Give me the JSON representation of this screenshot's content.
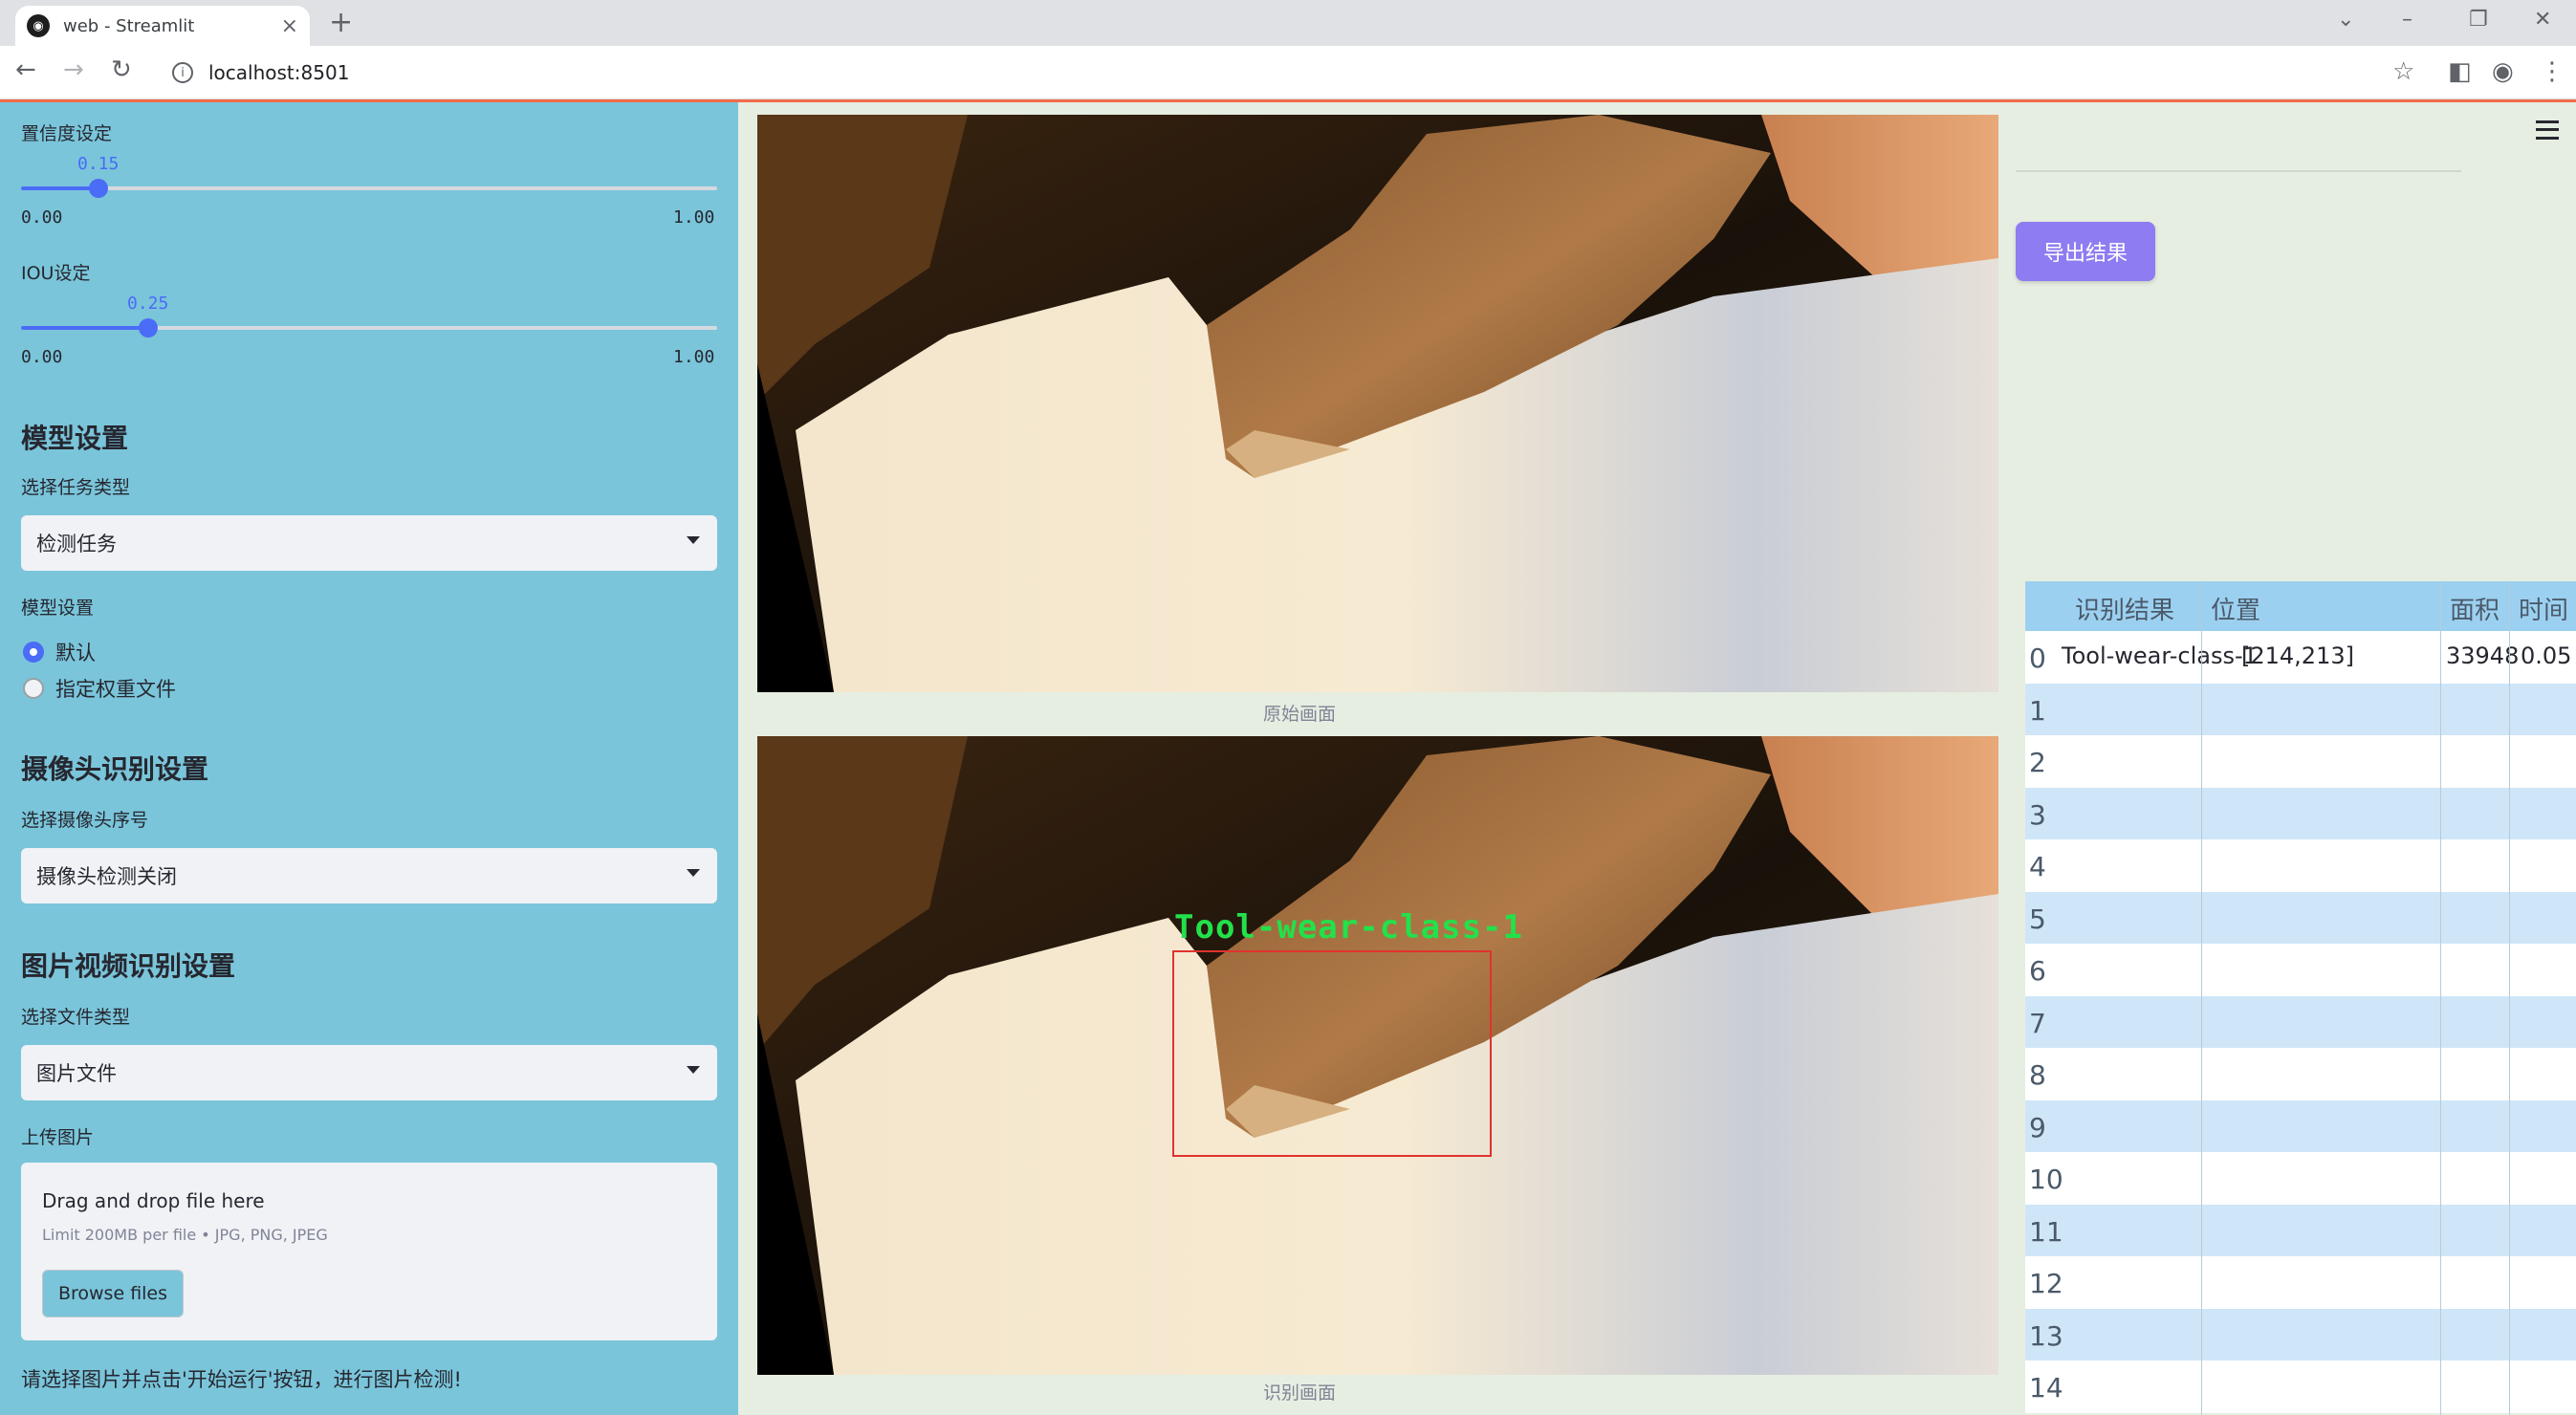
{
  "browser": {
    "tab_title": "web - Streamlit",
    "url": "localhost:8501"
  },
  "sidebar": {
    "confidence": {
      "label": "置信度设定",
      "value": "0.15",
      "level": 0.15,
      "min": "0.00",
      "max": "1.00"
    },
    "iou": {
      "label": "IOU设定",
      "value": "0.25",
      "level": 0.25,
      "min": "0.00",
      "max": "1.00"
    },
    "model_header": "模型设置",
    "task_label": "选择任务类型",
    "task_value": "检测任务",
    "model_label": "模型设置",
    "model_options": [
      "默认",
      "指定权重文件"
    ],
    "model_selected": 0,
    "camera_header": "摄像头识别设置",
    "camera_label": "选择摄像头序号",
    "camera_value": "摄像头检测关闭",
    "media_header": "图片视频识别设置",
    "file_type_label": "选择文件类型",
    "file_type_value": "图片文件",
    "upload_label": "上传图片",
    "uploader": {
      "drag_text": "Drag and drop file here",
      "limit_text": "Limit 200MB per file • JPG, PNG, JPEG",
      "browse_label": "Browse files"
    },
    "hint": "请选择图片并点击'开始运行'按钮，进行图片检测!"
  },
  "main": {
    "original_caption": "原始画面",
    "detected_caption": "识别画面",
    "detection_label": "Tool-wear-class-1"
  },
  "right": {
    "export_label": "导出结果",
    "table": {
      "headers": [
        "",
        "识别结果",
        "位置",
        "面积",
        "时间"
      ],
      "rows": [
        {
          "idx": "0",
          "result": "Tool-wear-class-1",
          "position": "[214,213]",
          "area": "33948",
          "time": "0.05"
        },
        {
          "idx": "1"
        },
        {
          "idx": "2"
        },
        {
          "idx": "3"
        },
        {
          "idx": "4"
        },
        {
          "idx": "5"
        },
        {
          "idx": "6"
        },
        {
          "idx": "7"
        },
        {
          "idx": "8"
        },
        {
          "idx": "9"
        },
        {
          "idx": "10"
        },
        {
          "idx": "11"
        },
        {
          "idx": "12"
        },
        {
          "idx": "13"
        },
        {
          "idx": "14"
        }
      ]
    }
  },
  "colors": {
    "sidebar_bg": "#7ac5da",
    "accent": "#4a6cf7",
    "export_button": "#8e7cf2",
    "detection_text": "#22e14a",
    "detection_box": "#e0332e"
  }
}
